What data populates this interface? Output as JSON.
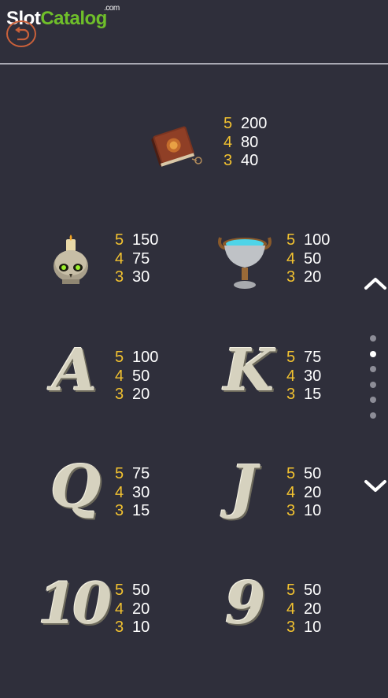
{
  "header": {
    "logo_slot": "Slot",
    "logo_catalog": "Catalog",
    "logo_com": ".com"
  },
  "paytable": {
    "book": {
      "rows": [
        {
          "count": "5",
          "pay": "200"
        },
        {
          "count": "4",
          "pay": "80"
        },
        {
          "count": "3",
          "pay": "40"
        }
      ]
    },
    "skull": {
      "rows": [
        {
          "count": "5",
          "pay": "150"
        },
        {
          "count": "4",
          "pay": "75"
        },
        {
          "count": "3",
          "pay": "30"
        }
      ]
    },
    "chalice": {
      "rows": [
        {
          "count": "5",
          "pay": "100"
        },
        {
          "count": "4",
          "pay": "50"
        },
        {
          "count": "3",
          "pay": "20"
        }
      ]
    },
    "ace": {
      "glyph": "A",
      "rows": [
        {
          "count": "5",
          "pay": "100"
        },
        {
          "count": "4",
          "pay": "50"
        },
        {
          "count": "3",
          "pay": "20"
        }
      ]
    },
    "king": {
      "glyph": "K",
      "rows": [
        {
          "count": "5",
          "pay": "75"
        },
        {
          "count": "4",
          "pay": "30"
        },
        {
          "count": "3",
          "pay": "15"
        }
      ]
    },
    "queen": {
      "glyph": "Q",
      "rows": [
        {
          "count": "5",
          "pay": "75"
        },
        {
          "count": "4",
          "pay": "30"
        },
        {
          "count": "3",
          "pay": "15"
        }
      ]
    },
    "jack": {
      "glyph": "J",
      "rows": [
        {
          "count": "5",
          "pay": "50"
        },
        {
          "count": "4",
          "pay": "20"
        },
        {
          "count": "3",
          "pay": "10"
        }
      ]
    },
    "ten": {
      "glyph": "10",
      "rows": [
        {
          "count": "5",
          "pay": "50"
        },
        {
          "count": "4",
          "pay": "20"
        },
        {
          "count": "3",
          "pay": "10"
        }
      ]
    },
    "nine": {
      "glyph": "9",
      "rows": [
        {
          "count": "5",
          "pay": "50"
        },
        {
          "count": "4",
          "pay": "20"
        },
        {
          "count": "3",
          "pay": "10"
        }
      ]
    }
  },
  "pager": {
    "total_pages": 6,
    "active_page": 2
  },
  "colors": {
    "background": "#2f2f3b",
    "count": "#f2c230",
    "value": "#ffffff",
    "brand_green": "#6fbf2a"
  }
}
